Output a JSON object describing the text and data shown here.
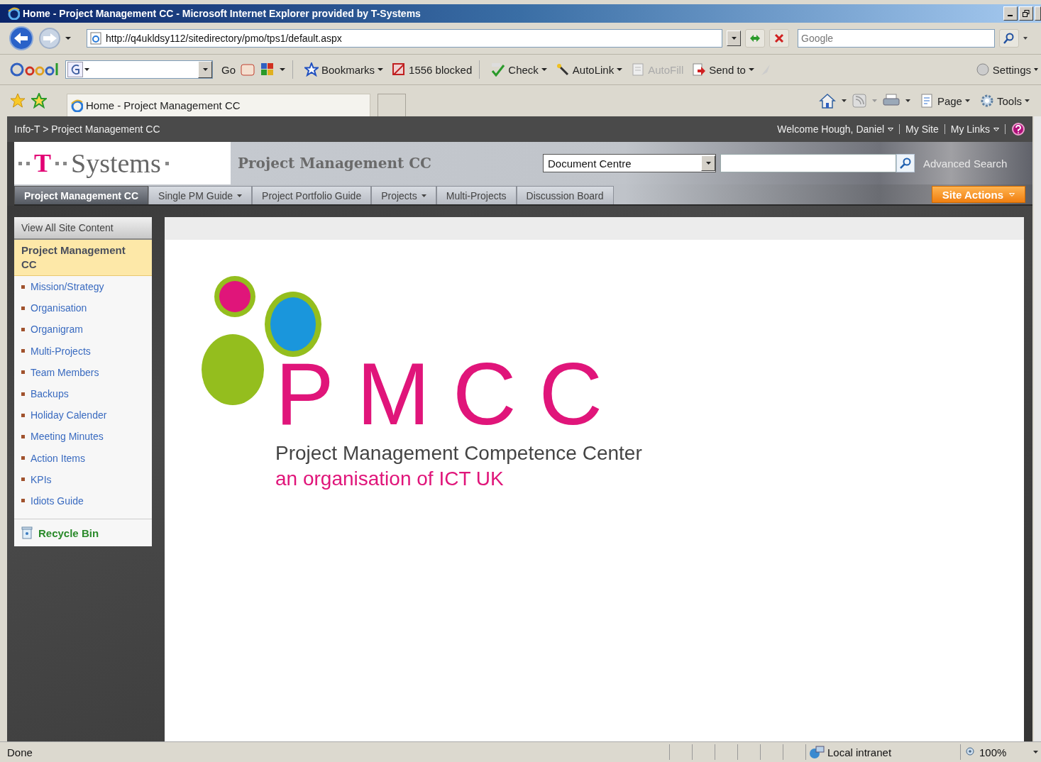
{
  "window": {
    "title": "Home - Project Management CC - Microsoft Internet Explorer provided by T-Systems"
  },
  "address_bar": {
    "url": "http://q4ukldsy112/sitedirectory/pmo/tps1/default.aspx",
    "search": {
      "placeholder": "Google"
    }
  },
  "google_toolbar": {
    "go": "Go",
    "items": [
      {
        "kind": "bookmark",
        "label": "Bookmarks",
        "menu": true,
        "disabled": false
      },
      {
        "kind": "popup",
        "label": "1556 blocked",
        "menu": false,
        "disabled": false
      },
      {
        "kind": "spell",
        "label": "Check",
        "menu": true,
        "disabled": false
      },
      {
        "kind": "wand",
        "label": "AutoLink",
        "menu": true,
        "disabled": false
      },
      {
        "kind": "form",
        "label": "AutoFill",
        "menu": false,
        "disabled": true
      },
      {
        "kind": "send",
        "label": "Send to",
        "menu": true,
        "disabled": false
      }
    ],
    "settings": "Settings"
  },
  "tab_bar": {
    "tab": "Home - Project Management CC",
    "commands": [
      {
        "kind": "page",
        "label": "Page"
      },
      {
        "kind": "tools",
        "label": "Tools"
      }
    ]
  },
  "site": {
    "breadcrumb": "Info-T > Project Management CC",
    "user_links": [
      {
        "label": "Welcome Hough, Daniel",
        "menu": true
      },
      {
        "label": "My Site",
        "menu": false
      },
      {
        "label": "My Links",
        "menu": true
      }
    ],
    "logo": {
      "mark": "T",
      "name": "Systems"
    },
    "title": "Project Management CC",
    "search_scope": "Document Centre",
    "advanced_search": "Advanced Search",
    "nav": [
      {
        "label": "Project Management CC",
        "selected": true,
        "menu": false
      },
      {
        "label": "Single PM Guide",
        "selected": false,
        "menu": true
      },
      {
        "label": "Project Portfolio Guide",
        "selected": false,
        "menu": false
      },
      {
        "label": "Projects",
        "selected": false,
        "menu": true
      },
      {
        "label": "Multi-Projects",
        "selected": false,
        "menu": false
      },
      {
        "label": "Discussion Board",
        "selected": false,
        "menu": false
      }
    ],
    "site_actions": "Site Actions"
  },
  "quick_launch": {
    "view_all": "View All Site Content",
    "heading": "Project Management CC",
    "items": [
      "Mission/Strategy",
      "Organisation",
      "Organigram",
      "Multi-Projects",
      "Team Members",
      "Backups",
      "Holiday Calender",
      "Meeting Minutes",
      "Action Items",
      "KPIs",
      "Idiots Guide"
    ],
    "recycle_bin": "Recycle Bin"
  },
  "content": {
    "logo": {
      "acronym": "PMCC",
      "name": "Project Management Competence Center",
      "tagline": "an organisation of ICT UK"
    }
  },
  "status_bar": {
    "status": "Done",
    "zone": "Local intranet",
    "zoom": "100%"
  }
}
